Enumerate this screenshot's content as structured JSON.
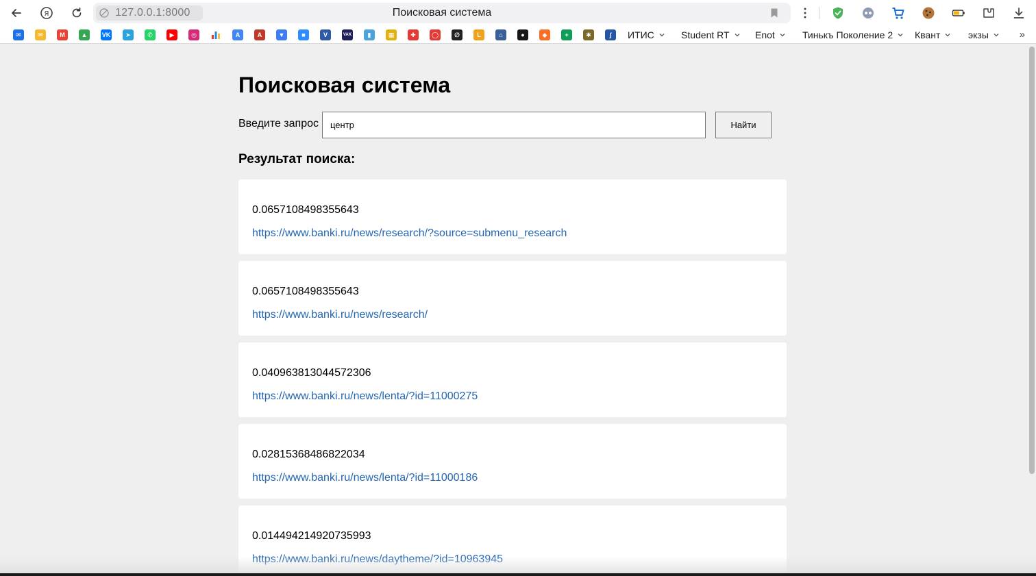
{
  "browser": {
    "url": "127.0.0.1:8000",
    "tab_title": "Поисковая система",
    "bookmark_folders": [
      {
        "label": "ИТИС"
      },
      {
        "label": "Student RT"
      },
      {
        "label": "Enot"
      },
      {
        "label": "Тинькъ Поколение 2"
      },
      {
        "label": "Квант"
      },
      {
        "label": "экзы"
      }
    ],
    "bookmark_icons": [
      {
        "name": "outlook-icon",
        "color": "#1a73e8",
        "glyph": "✉"
      },
      {
        "name": "yandex-mail-icon",
        "color": "#f5b82e",
        "glyph": "✉"
      },
      {
        "name": "gmail-icon",
        "color": "#ea4335",
        "glyph": "M"
      },
      {
        "name": "google-drive-icon",
        "color": "#34a853",
        "glyph": "▲"
      },
      {
        "name": "vk-icon",
        "color": "#0077ff",
        "glyph": "VK"
      },
      {
        "name": "telegram-icon",
        "color": "#2aa3df",
        "glyph": "➤"
      },
      {
        "name": "whatsapp-icon",
        "color": "#25d366",
        "glyph": "✆"
      },
      {
        "name": "youtube-icon",
        "color": "#ff0000",
        "glyph": "▶"
      },
      {
        "name": "instagram-icon",
        "color": "#d62976",
        "glyph": "◎"
      },
      {
        "name": "stats-icon",
        "color": "#ffffff",
        "glyph": ""
      },
      {
        "name": "translate-icon",
        "color": "#4285f4",
        "glyph": "A"
      },
      {
        "name": "dictionary-icon",
        "color": "#c0392b",
        "glyph": "A"
      },
      {
        "name": "vpn-icon",
        "color": "#3d7cf4",
        "glyph": "▼"
      },
      {
        "name": "zoom-icon",
        "color": "#2d8cff",
        "glyph": "■"
      },
      {
        "name": "vimeo-icon",
        "color": "#2f5aa8",
        "glyph": "V"
      },
      {
        "name": "vak-icon",
        "color": "#1e1e5a",
        "glyph": "VAK"
      },
      {
        "name": "bottle-icon",
        "color": "#4aa3df",
        "glyph": "▮"
      },
      {
        "name": "grid-book-icon",
        "color": "#e2b10e",
        "glyph": "▦"
      },
      {
        "name": "red-shield-icon",
        "color": "#e53935",
        "glyph": "✚"
      },
      {
        "name": "red-ring-icon",
        "color": "#e53935",
        "glyph": "◯"
      },
      {
        "name": "link-ring-icon",
        "color": "#222222",
        "glyph": "∅"
      },
      {
        "name": "leetcode-icon",
        "color": "#f0a21a",
        "glyph": "L"
      },
      {
        "name": "museum-icon",
        "color": "#3a5f9a",
        "glyph": "⌂"
      },
      {
        "name": "github-icon",
        "color": "#181717",
        "glyph": "●"
      },
      {
        "name": "gitlab-icon",
        "color": "#fc6d26",
        "glyph": "◆"
      },
      {
        "name": "sheets-plus-icon",
        "color": "#0f9d58",
        "glyph": "+"
      },
      {
        "name": "emblem-icon",
        "color": "#7a6a2a",
        "glyph": "✱"
      },
      {
        "name": "stepik-icon",
        "color": "#2257a7",
        "glyph": "ʃ"
      }
    ]
  },
  "page": {
    "title": "Поисковая система",
    "search": {
      "label": "Введите запрос",
      "value": "центр",
      "button_label": "Найти"
    },
    "results_heading": "Результат поиска:",
    "results": [
      {
        "score": "0.0657108498355643",
        "url": "https://www.banki.ru/news/research/?source=submenu_research"
      },
      {
        "score": "0.0657108498355643",
        "url": "https://www.banki.ru/news/research/"
      },
      {
        "score": "0.040963813044572306",
        "url": "https://www.banki.ru/news/lenta/?id=11000275"
      },
      {
        "score": "0.02815368486822034",
        "url": "https://www.banki.ru/news/lenta/?id=11000186"
      },
      {
        "score": "0.014494214920735993",
        "url": "https://www.banki.ru/news/daytheme/?id=10963945"
      }
    ],
    "link_color": "#2466b1"
  }
}
